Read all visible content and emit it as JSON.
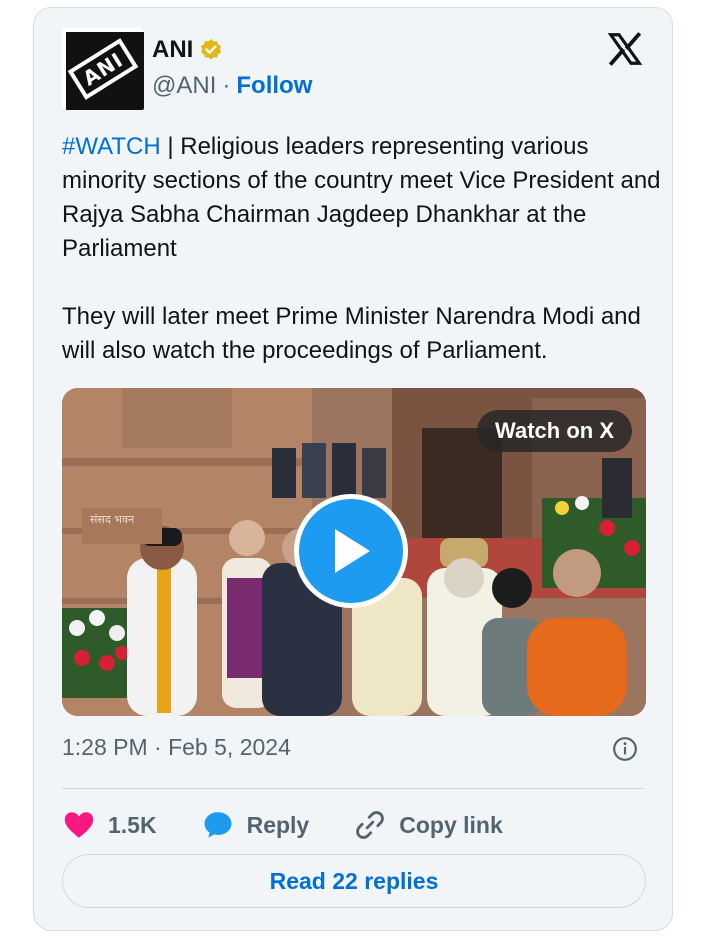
{
  "author": {
    "name": "ANI",
    "handle": "@ANI",
    "separator": "·",
    "follow_label": "Follow",
    "avatar_text": "ANI",
    "verified_color": "#e2b719"
  },
  "tweet": {
    "hashtag": "#WATCH",
    "text_part1": " | Religious leaders representing various minority sections of the country meet Vice President and Rajya Sabha Chairman Jagdeep Dhankhar at the Parliament\n\nThey will later meet Prime Minister Narendra Modi and will also watch the proceedings of Parliament."
  },
  "media": {
    "watch_label": "Watch on X",
    "building_sign": "संसद भवन"
  },
  "meta": {
    "timestamp": "1:28 PM · Feb 5, 2024"
  },
  "actions": {
    "likes_count": "1.5K",
    "reply_label": "Reply",
    "copy_link_label": "Copy link"
  },
  "footer": {
    "read_replies_label": "Read 22 replies"
  },
  "colors": {
    "accent": "#006fd6",
    "play_button": "#1d9bf0",
    "heart": "#f91880"
  },
  "icons": [
    "verified-badge-icon",
    "x-logo-icon",
    "play-icon",
    "info-icon",
    "heart-icon",
    "reply-bubble-icon",
    "link-icon"
  ]
}
